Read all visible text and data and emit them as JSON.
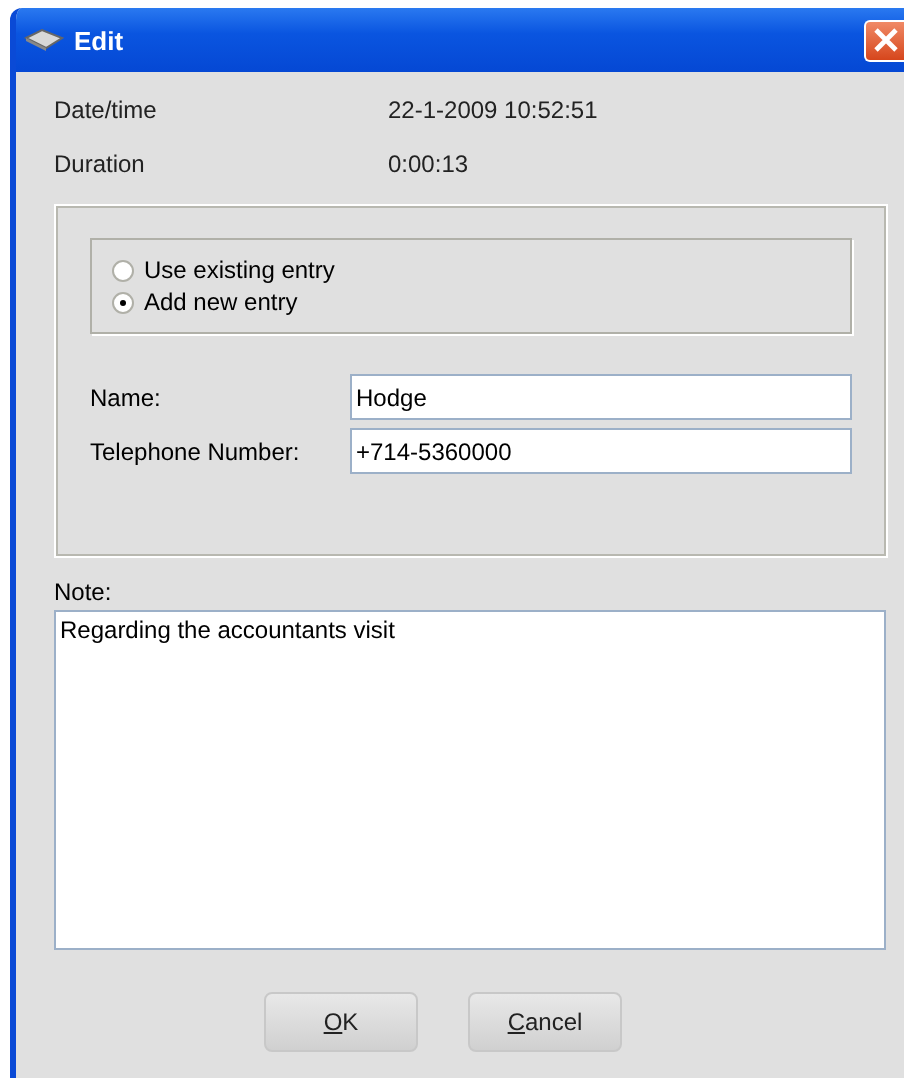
{
  "window": {
    "title": "Edit"
  },
  "info": [
    {
      "label": "Date/time",
      "value": "22-1-2009 10:52:51"
    },
    {
      "label": "Duration",
      "value": "0:00:13"
    }
  ],
  "entry_options": [
    {
      "label": "Use existing entry",
      "selected": false
    },
    {
      "label": "Add new entry",
      "selected": true
    }
  ],
  "fields": [
    {
      "label": "Name:",
      "value": "Hodge"
    },
    {
      "label": "Telephone Number:",
      "value": "+714-5360000"
    }
  ],
  "note": {
    "label": "Note:",
    "value": "Regarding the accountants visit"
  },
  "buttons": [
    {
      "label": "OK",
      "underline_first": true
    },
    {
      "label": "Cancel",
      "underline_first": true
    }
  ]
}
